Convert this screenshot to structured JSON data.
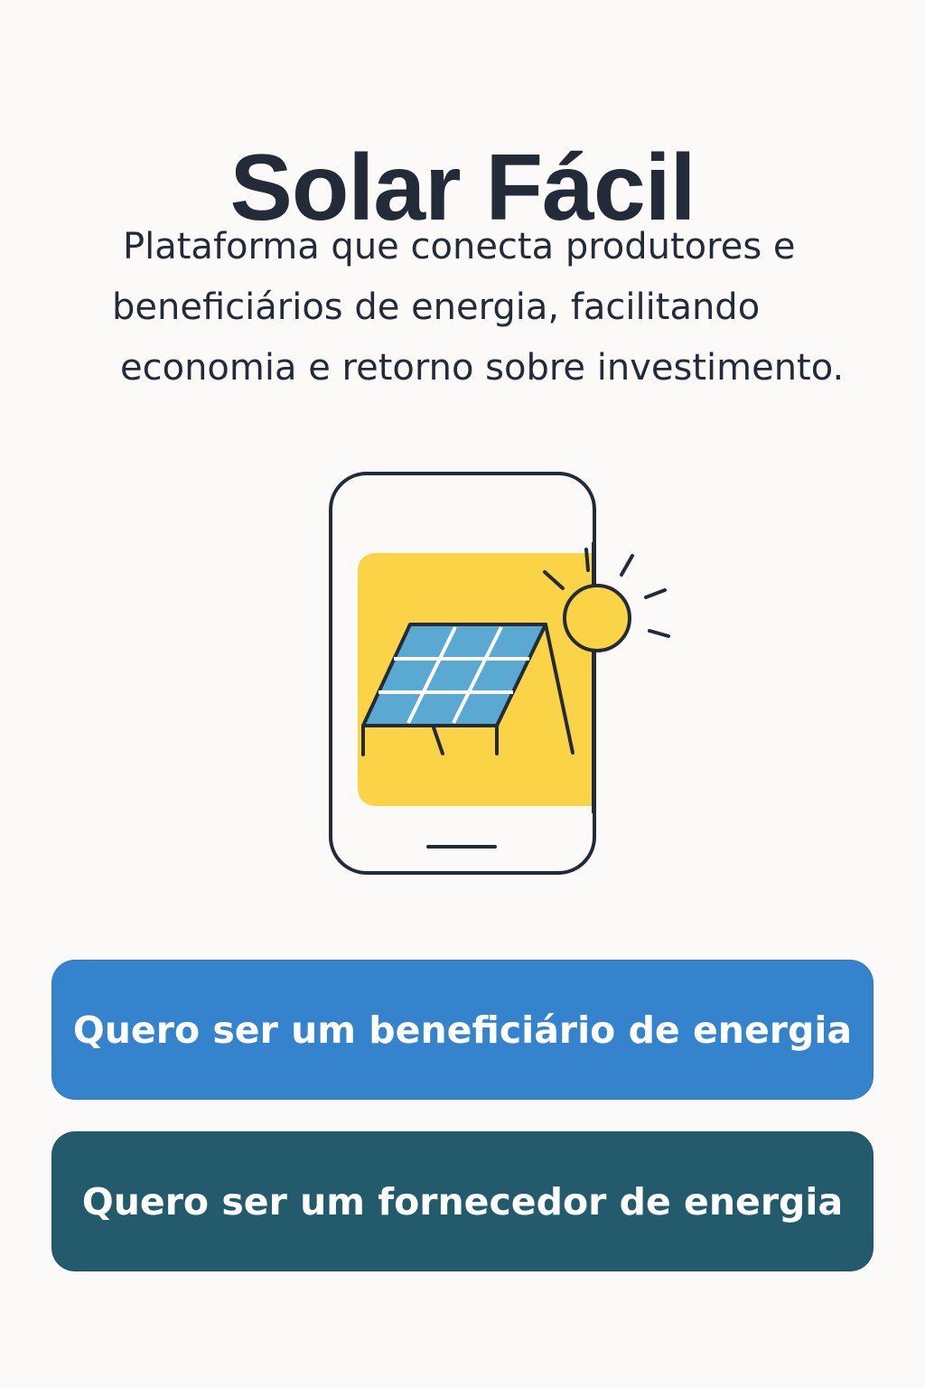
{
  "header": {
    "title": "Solar Fácil"
  },
  "description": {
    "lines": [
      "Plataforma que conecta produtores e",
      "beneficiários de energia, facilitando",
      "economia e retorno sobre investimento."
    ]
  },
  "illustration": {
    "icons": [
      "smartphone-icon",
      "solar-panel-icon",
      "sun-icon"
    ],
    "colors": {
      "outline": "#232b38",
      "screen_bg": "#fad346",
      "panel": "#5aa9d3",
      "sun": "#fad346"
    }
  },
  "actions": {
    "beneficiario_label": "Quero ser um beneficiário de energia",
    "fornecedor_label": "Quero ser um fornecedor de energia"
  },
  "colors": {
    "background": "#fbfaf8",
    "primary_button": "#3583cc",
    "secondary_button": "#235b6d",
    "text": "#232b38"
  }
}
